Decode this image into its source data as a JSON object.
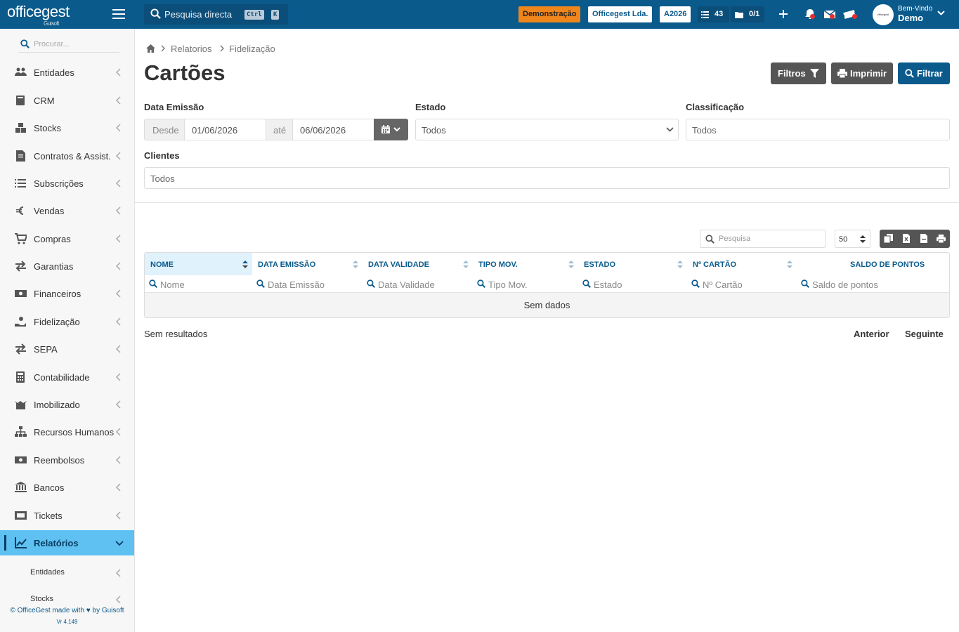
{
  "topbar": {
    "logo": "officegest",
    "logo_sub": "Guisoft",
    "search_placeholder": "Pesquisa directa",
    "kbd_ctrl": "Ctrl",
    "kbd_k": "K",
    "badge_demo": "Demonstração",
    "badge_company": "Officegest Lda.",
    "badge_year": "A2026",
    "tasks_count": "43",
    "docs_count": "0/1",
    "avatar_text": "officegest",
    "welcome_line1": "Bem-Vindo",
    "welcome_line2": "Demo",
    "colors": {
      "bar": "#0a5a8c",
      "accent_orange": "#f0861b"
    }
  },
  "sidebar": {
    "search_placeholder": "Procurar...",
    "items": [
      {
        "label": "Entidades",
        "icon": "users-icon"
      },
      {
        "label": "CRM",
        "icon": "book-icon"
      },
      {
        "label": "Stocks",
        "icon": "boxes-icon"
      },
      {
        "label": "Contratos & Assist.",
        "icon": "contract-icon"
      },
      {
        "label": "Subscrições",
        "icon": "list-icon"
      },
      {
        "label": "Vendas",
        "icon": "euro-icon"
      },
      {
        "label": "Compras",
        "icon": "cart-icon"
      },
      {
        "label": "Garantias",
        "icon": "exchange-icon"
      },
      {
        "label": "Financeiros",
        "icon": "money-icon"
      },
      {
        "label": "Fidelização",
        "icon": "hand-coin-icon"
      },
      {
        "label": "SEPA",
        "icon": "exchange-icon"
      },
      {
        "label": "Contabilidade",
        "icon": "calculator-icon"
      },
      {
        "label": "Imobilizado",
        "icon": "box-open-icon"
      },
      {
        "label": "Recursos Humanos",
        "icon": "sitemap-icon"
      },
      {
        "label": "Reembolsos",
        "icon": "money-icon"
      },
      {
        "label": "Bancos",
        "icon": "bank-icon"
      },
      {
        "label": "Tickets",
        "icon": "ticket-icon"
      },
      {
        "label": "Relatórios",
        "icon": "chart-icon"
      }
    ],
    "subitems": [
      {
        "label": "Entidades"
      },
      {
        "label": "Stocks"
      }
    ],
    "footer": "© OfficeGest made with ♥ by Guisoft",
    "version": "Vr 4.149",
    "colors": {
      "active": "#5ec1f2"
    }
  },
  "breadcrumb": {
    "level1": "Relatorios",
    "level2": "Fidelização"
  },
  "page": {
    "title": "Cartões",
    "btn_filters": "Filtros",
    "btn_print": "Imprimir",
    "btn_filter": "Filtrar"
  },
  "filters": {
    "date_label": "Data Emissão",
    "from_label": "Desde",
    "from_value": "01/06/2026",
    "to_label": "até",
    "to_value": "06/06/2026",
    "state_label": "Estado",
    "state_value": "Todos",
    "class_label": "Classificação",
    "class_value": "Todos",
    "clients_label": "Clientes",
    "clients_value": "Todos"
  },
  "table": {
    "search_placeholder": "Pesquisa",
    "page_size": "50",
    "columns": [
      {
        "header": "Nome",
        "filter": "Nome"
      },
      {
        "header": "Data Emissão",
        "filter": "Data Emissão"
      },
      {
        "header": "Data Validade",
        "filter": "Data Validade"
      },
      {
        "header": "Tipo Mov.",
        "filter": "Tipo Mov."
      },
      {
        "header": "Estado",
        "filter": "Estado"
      },
      {
        "header": "Nº Cartão",
        "filter": "Nº Cartão"
      },
      {
        "header": "Saldo de pontos",
        "filter": "Saldo de pontos"
      }
    ],
    "empty_text": "Sem dados",
    "results_text": "Sem resultados",
    "prev": "Anterior",
    "next": "Seguinte"
  }
}
